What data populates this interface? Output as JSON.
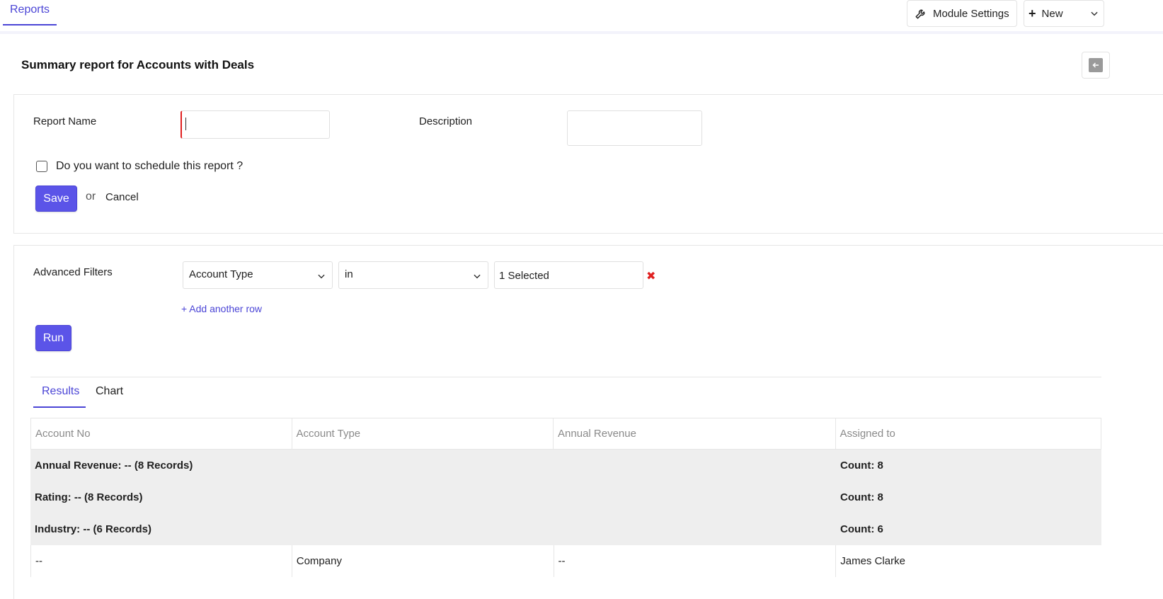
{
  "topbar": {
    "tab_reports": "Reports",
    "module_settings_label": "Module Settings",
    "new_label": "New"
  },
  "header": {
    "title": "Summary report for Accounts with Deals"
  },
  "form": {
    "report_name_label": "Report Name",
    "report_name_value": "",
    "description_label": "Description",
    "description_value": "",
    "schedule_label": "Do you want to schedule this report ?",
    "schedule_checked": false,
    "save_label": "Save",
    "or_text": "or",
    "cancel_label": "Cancel"
  },
  "filters": {
    "label": "Advanced Filters",
    "field_value": "Account Type",
    "operator_value": "in",
    "selection_value": "1 Selected",
    "add_row_label": "+ Add another row",
    "run_label": "Run"
  },
  "results_tabs": [
    {
      "label": "Results",
      "active": true
    },
    {
      "label": "Chart",
      "active": false
    }
  ],
  "table": {
    "columns": [
      "Account No",
      "Account Type",
      "Annual Revenue",
      "Assigned to"
    ],
    "group_rows": [
      {
        "label": "Annual Revenue: -- (8 Records)",
        "count": "Count: 8"
      },
      {
        "label": "Rating: -- (8 Records)",
        "count": "Count: 8"
      },
      {
        "label": "Industry: -- (6 Records)",
        "count": "Count: 6"
      }
    ],
    "rows": [
      [
        "--",
        "Company",
        "--",
        "James Clarke"
      ]
    ]
  },
  "colors": {
    "accent": "#4b45d6",
    "primary_button": "#5b54e8",
    "required_marker": "#e02020",
    "group_row_bg": "#eeeeee"
  }
}
